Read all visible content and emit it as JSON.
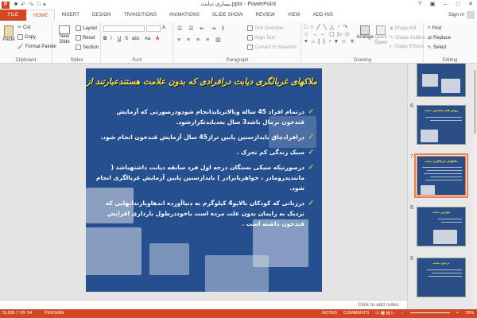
{
  "titlebar": {
    "app_icon": "P",
    "qat": [
      "■",
      "↶",
      "↷",
      "□",
      "▾"
    ],
    "title": "بیماری دیابت.pptx - PowerPoint",
    "controls": [
      "?",
      "▣",
      "–",
      "□",
      "✕"
    ]
  },
  "tabs": [
    "FILE",
    "HOME",
    "INSERT",
    "DESIGN",
    "TRANSITIONS",
    "ANIMATIONS",
    "SLIDE SHOW",
    "REVIEW",
    "VIEW",
    "ADD-INS"
  ],
  "active_tab": "HOME",
  "signin": "Sign in",
  "ribbon": {
    "clipboard": {
      "paste": "Paste",
      "cut": "Cut",
      "copy": "Copy",
      "format_painter": "Format Painter",
      "label": "Clipboard"
    },
    "slides": {
      "new_slide": "New Slide",
      "layout": "Layout",
      "reset": "Reset",
      "section": "Section",
      "label": "Slides"
    },
    "font": {
      "label": "Font",
      "clear": "A",
      "grow": "A˄",
      "shrink": "A˅",
      "bold": "B",
      "italic": "I",
      "underline": "U",
      "strike": "S",
      "abc": "abc",
      "case": "Aa",
      "color": "A"
    },
    "paragraph": {
      "text_direction": "Text Direction",
      "align_text": "Align Text",
      "convert_smartart": "Convert to SmartArt",
      "label": "Paragraph"
    },
    "drawing": {
      "shapes": "□ ○ ╱ ╲ △ ↑ ↷ ☆ → ← ▢ ▷ ◇ ✦ ⌂ { } ◔ ♥ ☺ ☀",
      "arrange": "Arrange",
      "quick_styles": "Quick Styles",
      "shape_fill": "Shape Fill",
      "shape_outline": "Shape Outline",
      "shape_effects": "Shape Effects",
      "label": "Drawing"
    },
    "editing": {
      "find": "Find",
      "replace": "Replace",
      "select": "Select",
      "label": "Editing"
    }
  },
  "slide": {
    "title": "ملاکهای غربالگری دیابت درافرادی که بدون علامت هستندعبارتند از :",
    "bullets": [
      "درتمام افراد 45 ساله وبالاتربایدانجام شودودرصورتی که آزمایش قندخون نرمال باشد3 سال بعدبایدتکرارشود.",
      "درافرادچاق بایدازسنین پایین تراز45 سال آزمایش قندخون انجام شود.",
      "سبک زندگی کم تحرک .",
      "درصورتیکه سیکی بستگان درجه اول فرد سابقه دیابت داشتهباشد ( مانندپدرومادر ، خواهریابرادر ) بایدازسنین پایین آزمایش غربالگری انجام شود.",
      "درزنانی که کودکان بالایو4 کیلوگرم به دنیاآورده اندهاویازندانهایی که نزدیک به زایمان بدون علت مرده است یاخوددرطول بارداری افزایش قندخون داشته است ."
    ]
  },
  "notes_placeholder": "Click to add notes",
  "thumbnails": [
    {
      "num": "5",
      "title": ""
    },
    {
      "num": "6",
      "title": "روش های تشخیص دیابت"
    },
    {
      "num": "7",
      "title": "ملاکهای غربالگری دیابت"
    },
    {
      "num": "8",
      "title": "عوارض دیابت"
    },
    {
      "num": "9",
      "title": "درمان دیابت"
    }
  ],
  "active_thumb": "7",
  "status": {
    "slide": "SLIDE 7 OF 34",
    "language": "PERSIAN",
    "notes": "NOTES",
    "comments": "COMMENTS",
    "zoom": "70%"
  },
  "colors": {
    "accent": "#d24726",
    "slide_bg": "#264f90",
    "title": "#f7e34a",
    "check": "#9be04f"
  }
}
